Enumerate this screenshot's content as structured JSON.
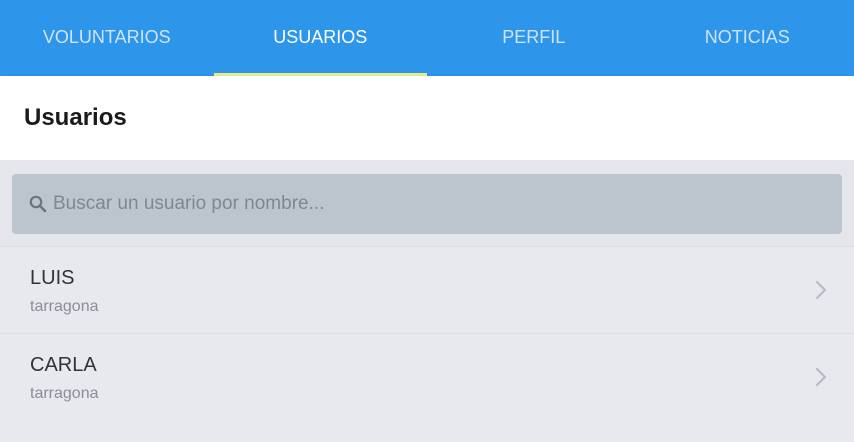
{
  "tabs": [
    {
      "label": "VOLUNTARIOS",
      "active": false
    },
    {
      "label": "USUARIOS",
      "active": true
    },
    {
      "label": "PERFIL",
      "active": false
    },
    {
      "label": "NOTICIAS",
      "active": false
    }
  ],
  "header": {
    "title": "Usuarios"
  },
  "search": {
    "placeholder": "Buscar un usuario por nombre...",
    "value": "",
    "icon": "search-icon"
  },
  "users": [
    {
      "name": "LUIS",
      "location": "tarragona",
      "icon": "chevron-right-icon"
    },
    {
      "name": "CARLA",
      "location": "tarragona",
      "icon": "chevron-right-icon"
    }
  ],
  "colors": {
    "tabbar": "#2d95ea",
    "tab_inactive": "#cfe4fa",
    "tab_active": "#ffffff",
    "tab_indicator": "#e6ec8c",
    "search_box": "#bcc5cd",
    "background": "#e7e9ee"
  }
}
